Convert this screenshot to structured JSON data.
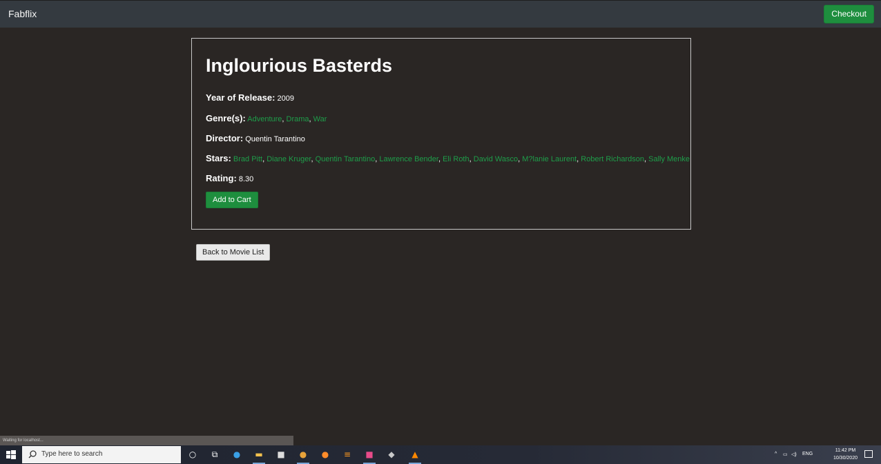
{
  "navbar": {
    "brand": "Fabflix",
    "checkout_label": "Checkout"
  },
  "movie": {
    "title": "Inglourious Basterds",
    "year_label": "Year of Release:",
    "year": "2009",
    "genres_label": "Genre(s):",
    "genres": [
      "Adventure",
      "Drama",
      "War"
    ],
    "director_label": "Director:",
    "director": "Quentin Tarantino",
    "stars_label": "Stars:",
    "stars": [
      "Brad Pitt",
      "Diane Kruger",
      "Quentin Tarantino",
      "Lawrence Bender",
      "Eli Roth",
      "David Wasco",
      "M?lanie Laurent",
      "Robert Richardson",
      "Sally Menke"
    ],
    "rating_label": "Rating:",
    "rating": "8.30",
    "add_to_cart_label": "Add to Cart"
  },
  "back_label": "Back to Movie List",
  "status_text": "Waiting for localhost...",
  "taskbar": {
    "search_placeholder": "Type here to search",
    "language": "ENG",
    "time": "11:42 PM",
    "date": "10/30/2020"
  },
  "colors": {
    "background": "#2a2624",
    "navbar": "#343a40",
    "accent_green": "#1e8e3e",
    "link_green": "#1e9e4a"
  },
  "icons": [
    "windows-start-icon",
    "search-icon",
    "cortana-icon",
    "task-view-icon",
    "edge-icon",
    "file-explorer-icon",
    "store-icon",
    "chrome-icon",
    "firefox-icon",
    "sublime-icon",
    "intellij-icon",
    "app-icon",
    "vlc-icon",
    "chevron-up-icon",
    "network-icon",
    "volume-icon",
    "notification-icon"
  ]
}
